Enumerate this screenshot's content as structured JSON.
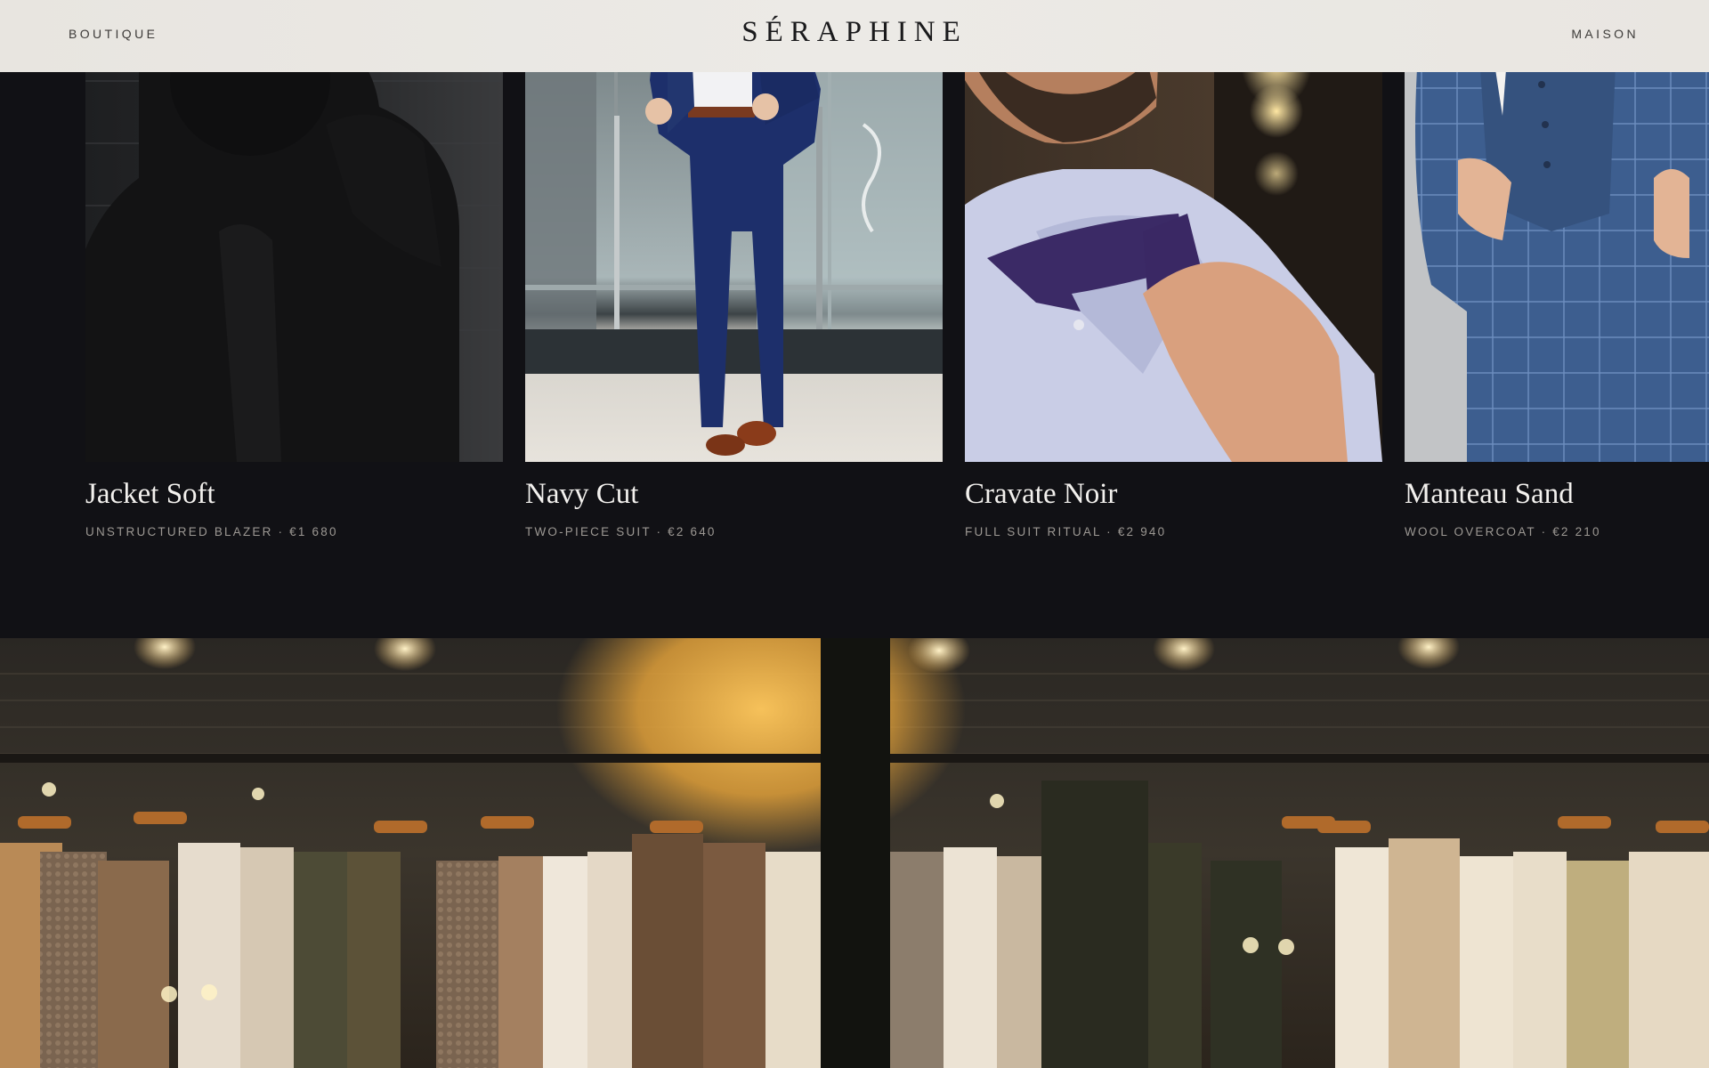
{
  "header": {
    "nav_left": "BOUTIQUE",
    "logo": "SÉRAPHINE",
    "nav_right": "MAISON"
  },
  "products": [
    {
      "name": "Jacket Soft",
      "meta": "UNSTRUCTURED BLAZER · €1 680"
    },
    {
      "name": "Navy Cut",
      "meta": "TWO-PIECE SUIT · €2 640"
    },
    {
      "name": "Cravate Noir",
      "meta": "FULL SUIT RITUAL · €2 940"
    },
    {
      "name": "Manteau Sand",
      "meta": "WOOL OVERCOAT · €2 210"
    }
  ],
  "colors": {
    "background": "#111115",
    "header_bg": "#eceae6",
    "accent_navy": "#1d2f6b",
    "accent_amber": "#e0a03a"
  }
}
